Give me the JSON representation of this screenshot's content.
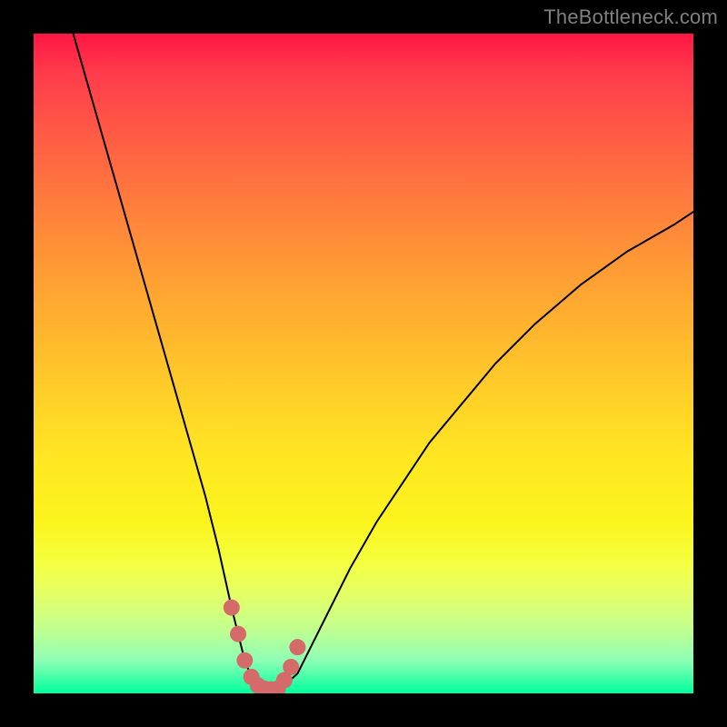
{
  "watermark": "TheBottleneck.com",
  "colors": {
    "page_bg": "#000000",
    "curve": "#000000",
    "marker": "#d46a6a",
    "gradient_top": "#ff1744",
    "gradient_bottom": "#00ff9e"
  },
  "chart_data": {
    "type": "line",
    "title": "",
    "xlabel": "",
    "ylabel": "",
    "xlim": [
      0,
      100
    ],
    "ylim": [
      0,
      100
    ],
    "grid": false,
    "series": [
      {
        "name": "bottleneck-curve",
        "x": [
          6,
          8,
          10,
          12,
          14,
          16,
          18,
          20,
          22,
          24,
          26,
          28,
          30,
          31,
          32,
          33,
          34,
          35,
          36,
          37,
          38,
          40,
          42,
          45,
          48,
          52,
          56,
          60,
          65,
          70,
          76,
          83,
          90,
          97,
          100
        ],
        "y": [
          100,
          93,
          86,
          79,
          72,
          65,
          58,
          51,
          44,
          37,
          30,
          22,
          13,
          9,
          5,
          2.5,
          1.2,
          0.7,
          0.6,
          0.7,
          1.2,
          3,
          7,
          13,
          19,
          26,
          32,
          38,
          44,
          50,
          56,
          62,
          67,
          71,
          73
        ]
      }
    ],
    "markers": {
      "name": "highlight-points",
      "x": [
        30,
        31,
        32,
        33,
        34,
        35,
        36,
        37,
        38,
        39,
        40
      ],
      "y": [
        13,
        9,
        5,
        2.5,
        1.2,
        0.7,
        0.6,
        0.7,
        2,
        4,
        7
      ]
    }
  }
}
